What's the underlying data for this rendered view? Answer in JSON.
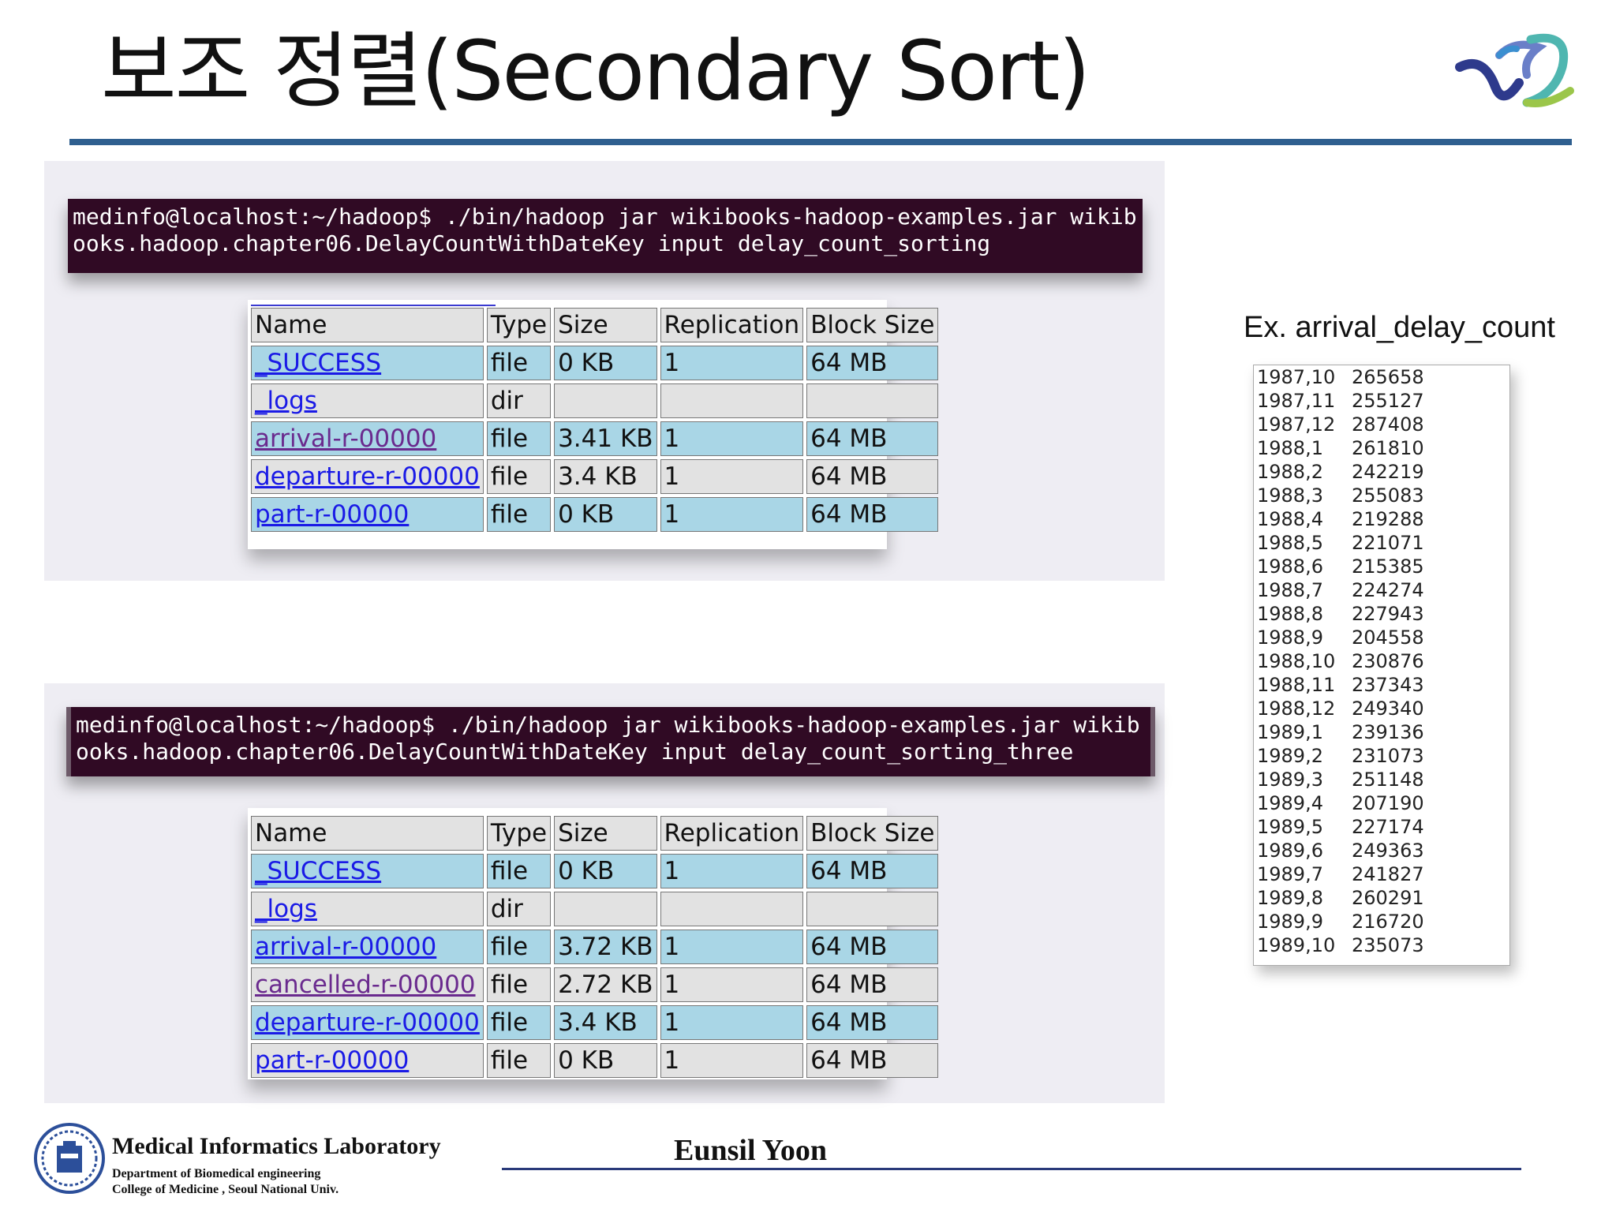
{
  "title": "보조 정렬(Secondary Sort)",
  "terminal_top": {
    "line1": "medinfo@localhost:~/hadoop$ ./bin/hadoop jar wikibooks-hadoop-examples.jar wikib",
    "line2": "ooks.hadoop.chapter06.DelayCountWithDateKey input delay_count_sorting"
  },
  "terminal_bottom": {
    "line1": "medinfo@localhost:~/hadoop$ ./bin/hadoop jar wikibooks-hadoop-examples.jar wikib",
    "line2": "ooks.hadoop.chapter06.DelayCountWithDateKey input delay_count_sorting_three"
  },
  "table_headers": [
    "Name",
    "Type",
    "Size",
    "Replication",
    "Block Size"
  ],
  "listing_top": [
    {
      "name": "_SUCCESS",
      "type": "file",
      "size": "0 KB",
      "replication": "1",
      "block": "64 MB"
    },
    {
      "name": "_logs",
      "type": "dir",
      "size": "",
      "replication": "",
      "block": ""
    },
    {
      "name": "arrival-r-00000",
      "type": "file",
      "size": "3.41 KB",
      "replication": "1",
      "block": "64 MB"
    },
    {
      "name": "departure-r-00000",
      "type": "file",
      "size": "3.4 KB",
      "replication": "1",
      "block": "64 MB"
    },
    {
      "name": "part-r-00000",
      "type": "file",
      "size": "0 KB",
      "replication": "1",
      "block": "64 MB"
    }
  ],
  "listing_bottom": [
    {
      "name": "_SUCCESS",
      "type": "file",
      "size": "0 KB",
      "replication": "1",
      "block": "64 MB"
    },
    {
      "name": "_logs",
      "type": "dir",
      "size": "",
      "replication": "",
      "block": ""
    },
    {
      "name": "arrival-r-00000",
      "type": "file",
      "size": "3.72 KB",
      "replication": "1",
      "block": "64 MB"
    },
    {
      "name": "cancelled-r-00000",
      "type": "file",
      "size": "2.72 KB",
      "replication": "1",
      "block": "64 MB"
    },
    {
      "name": "departure-r-00000",
      "type": "file",
      "size": "3.4 KB",
      "replication": "1",
      "block": "64 MB"
    },
    {
      "name": "part-r-00000",
      "type": "file",
      "size": "0 KB",
      "replication": "1",
      "block": "64 MB"
    }
  ],
  "example_label": "Ex. arrival_delay_count",
  "arrival_delay_count": [
    [
      "1987,10",
      "265658"
    ],
    [
      "1987,11",
      "255127"
    ],
    [
      "1987,12",
      "287408"
    ],
    [
      "1988,1",
      "261810"
    ],
    [
      "1988,2",
      "242219"
    ],
    [
      "1988,3",
      "255083"
    ],
    [
      "1988,4",
      "219288"
    ],
    [
      "1988,5",
      "221071"
    ],
    [
      "1988,6",
      "215385"
    ],
    [
      "1988,7",
      "224274"
    ],
    [
      "1988,8",
      "227943"
    ],
    [
      "1988,9",
      "204558"
    ],
    [
      "1988,10",
      "230876"
    ],
    [
      "1988,11",
      "237343"
    ],
    [
      "1988,12",
      "249340"
    ],
    [
      "1989,1",
      "239136"
    ],
    [
      "1989,2",
      "231073"
    ],
    [
      "1989,3",
      "251148"
    ],
    [
      "1989,4",
      "207190"
    ],
    [
      "1989,5",
      "227174"
    ],
    [
      "1989,6",
      "249363"
    ],
    [
      "1989,7",
      "241827"
    ],
    [
      "1989,8",
      "260291"
    ],
    [
      "1989,9",
      "216720"
    ],
    [
      "1989,10",
      "235073"
    ]
  ],
  "footer": {
    "lab": "Medical  Informatics Laboratory",
    "dept_line1": "Department of Biomedical engineering",
    "dept_line2": "College of Medicine , Seoul  National  Univ.",
    "author": "Eunsil Yoon"
  },
  "colors": {
    "rule": "#2f5f8f",
    "terminal_bg": "#300a24",
    "row_blue": "#a9d6e6",
    "row_gray": "#e2e2e2",
    "link": "#1a1ae6",
    "visited_link": "#6a2a8e"
  }
}
